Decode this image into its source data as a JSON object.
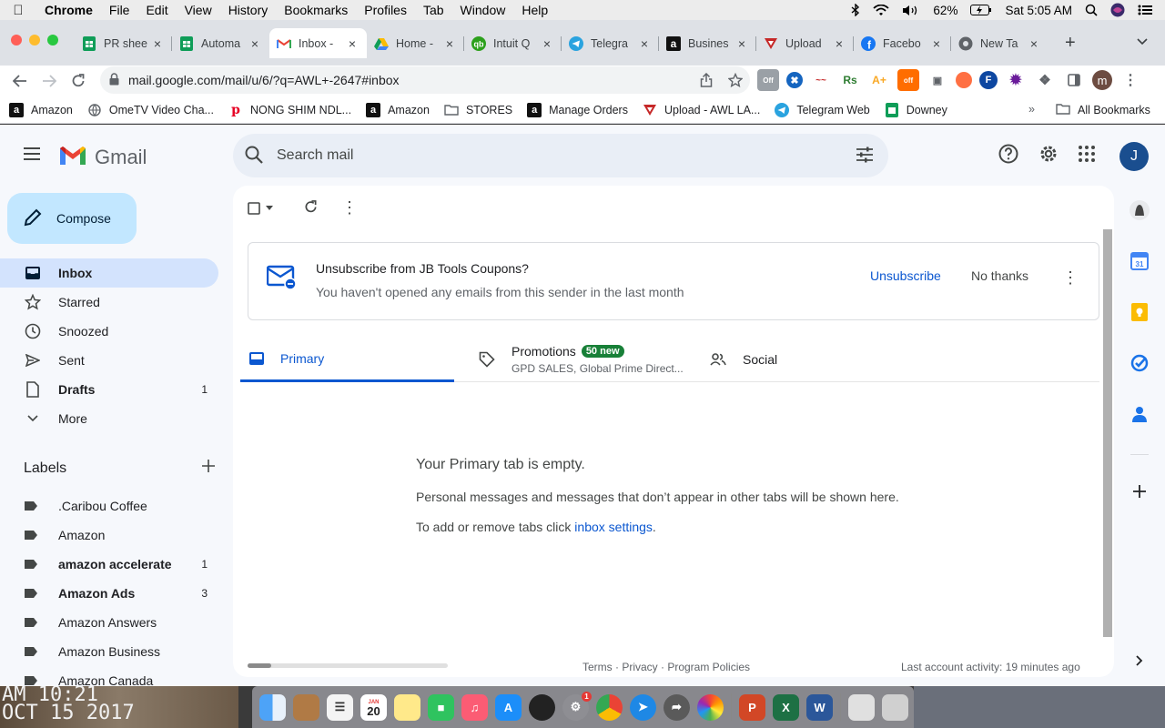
{
  "menubar": {
    "app": "Chrome",
    "items": [
      "File",
      "Edit",
      "View",
      "History",
      "Bookmarks",
      "Profiles",
      "Tab",
      "Window",
      "Help"
    ],
    "battery": "62%",
    "clock": "Sat 5:05 AM"
  },
  "tabs": [
    {
      "title": "PR shee",
      "icon": "sheets-icon"
    },
    {
      "title": "Automa",
      "icon": "sheets-icon"
    },
    {
      "title": "Inbox -",
      "icon": "gmail-icon"
    },
    {
      "title": "Home -",
      "icon": "drive-icon"
    },
    {
      "title": "Intuit Q",
      "icon": "quickbooks-icon"
    },
    {
      "title": "Telegra",
      "icon": "telegram-icon"
    },
    {
      "title": "Busines",
      "icon": "amazon-icon"
    },
    {
      "title": "Upload",
      "icon": "awl-icon"
    },
    {
      "title": "Facebo",
      "icon": "facebook-icon"
    },
    {
      "title": "New Ta",
      "icon": "chrome-icon"
    }
  ],
  "toolbar": {
    "url": "mail.google.com/mail/u/6/?q=AWL+-2647#inbox",
    "profile_initial": "m"
  },
  "bookmarks": [
    {
      "label": "Amazon",
      "icon": "amazon-icon"
    },
    {
      "label": "OmeTV Video Cha...",
      "icon": "globe-icon"
    },
    {
      "label": "NONG SHIM NDL...",
      "icon": "pinterest-icon"
    },
    {
      "label": "Amazon",
      "icon": "amazon-icon"
    },
    {
      "label": "STORES",
      "icon": "folder-icon"
    },
    {
      "label": "Manage Orders",
      "icon": "amazon-icon"
    },
    {
      "label": "Upload - AWL LA...",
      "icon": "awl-icon"
    },
    {
      "label": "Telegram Web",
      "icon": "telegram-icon"
    },
    {
      "label": "Downey",
      "icon": "sheets-icon"
    }
  ],
  "bookmarks_all": "All Bookmarks",
  "gmail": {
    "logo_text": "Gmail",
    "search_placeholder": "Search mail",
    "avatar": "J",
    "compose": "Compose",
    "nav": [
      {
        "label": "Inbox",
        "count": ""
      },
      {
        "label": "Starred",
        "count": ""
      },
      {
        "label": "Snoozed",
        "count": ""
      },
      {
        "label": "Sent",
        "count": ""
      },
      {
        "label": "Drafts",
        "count": "1"
      },
      {
        "label": "More",
        "count": ""
      }
    ],
    "labels_title": "Labels",
    "labels": [
      {
        "label": ".Caribou Coffee",
        "count": ""
      },
      {
        "label": "Amazon",
        "count": ""
      },
      {
        "label": "amazon accelerate",
        "count": "1"
      },
      {
        "label": "Amazon Ads",
        "count": "3"
      },
      {
        "label": "Amazon Answers",
        "count": ""
      },
      {
        "label": "Amazon Business",
        "count": ""
      },
      {
        "label": "Amazon Canada",
        "count": ""
      }
    ],
    "unsub": {
      "title": "Unsubscribe from JB Tools Coupons?",
      "subtitle": "You haven't opened any emails from this sender in the last month",
      "unsubscribe": "Unsubscribe",
      "no_thanks": "No thanks"
    },
    "cat_tabs": {
      "primary": "Primary",
      "promotions": "Promotions",
      "promotions_badge": "50 new",
      "promotions_sub": "GPD SALES, Global Prime Direct...",
      "social": "Social"
    },
    "empty": {
      "title": "Your Primary tab is empty.",
      "body": "Personal messages and messages that don’t appear in other tabs will be shown here.",
      "settings_prefix": "To add or remove tabs click ",
      "settings_link": "inbox settings",
      "settings_suffix": "."
    },
    "footer": {
      "links": "Terms · Privacy · Program Policies",
      "activity": "Last account activity: 19 minutes ago"
    }
  },
  "desktop": {
    "line1": "AM 10:21",
    "line2": "OCT 15 2017"
  },
  "dock": {
    "calendar_month": "JAN",
    "calendar_day": "20",
    "settings_badge": "1"
  }
}
